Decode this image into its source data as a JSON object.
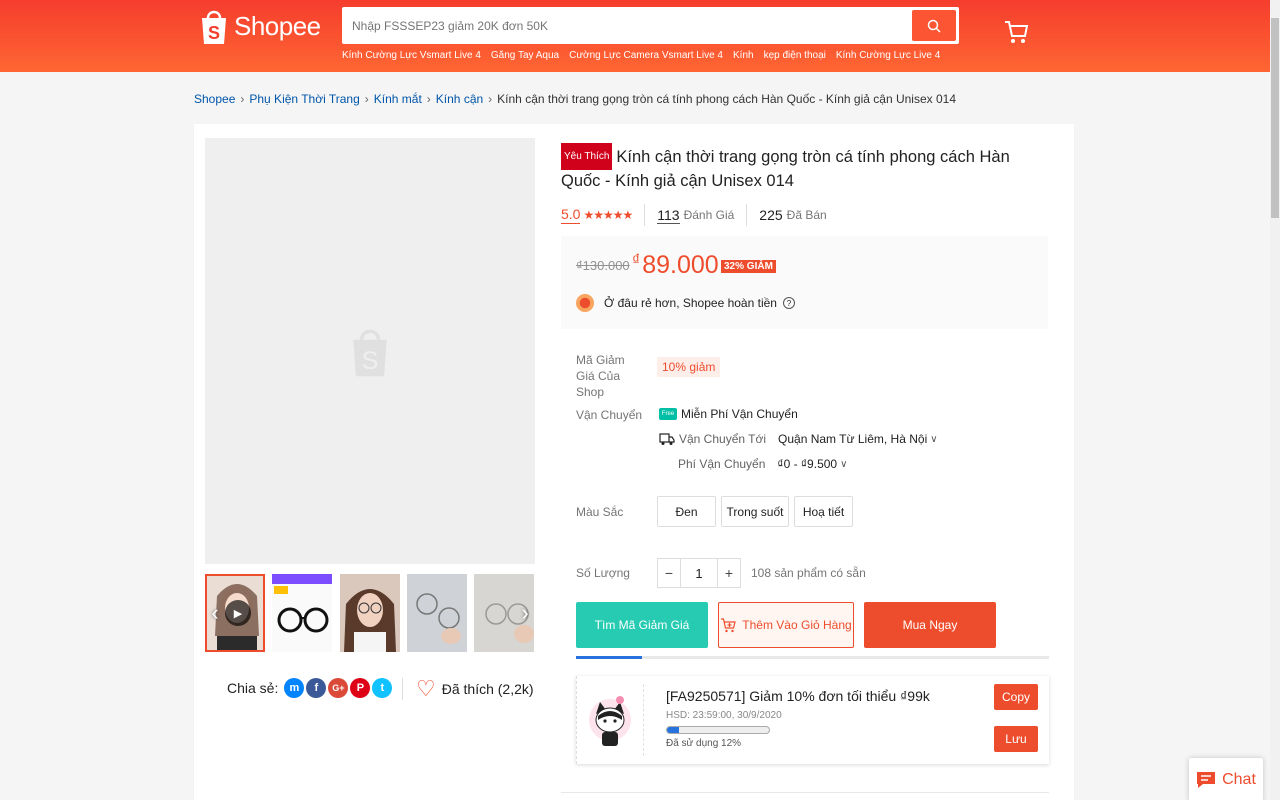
{
  "header": {
    "logo_text": "Shopee",
    "search_placeholder": "Nhập FSSSEP23 giảm 20K đơn 50K",
    "hot_words": [
      "Kính Cường Lực Vsmart Live 4",
      "Găng Tay Aqua",
      "Cường Lực Camera Vsmart Live 4",
      "Kính",
      "kẹp điện thoại",
      "Kính Cường Lực Live 4"
    ],
    "brand_color": "#ee4d2d"
  },
  "breadcrumb": [
    "Shopee",
    "Phụ Kiện Thời Trang",
    "Kính mắt",
    "Kính cận",
    "Kính cận thời trang gọng tròn cá tính phong cách Hàn Quốc - Kính giả cận Unisex 014"
  ],
  "product": {
    "badge": "Yêu Thích",
    "title": "Kính cận thời trang gọng tròn cá tính phong cách Hàn Quốc - Kính giả cận Unisex 014",
    "rating": "5.0",
    "stars": "★★★★★",
    "reviews_count": "113",
    "reviews_label": "Đánh Giá",
    "sold_count": "225",
    "sold_label": "Đã Bán",
    "old_price": "₫130.000",
    "price_symbol": "₫",
    "price": "89.000",
    "discount": "32% GIẢM",
    "guarantee": "Ở đâu rẻ hơn, Shopee hoàn tiền"
  },
  "voucher_row": {
    "label": "Mã Giảm Giá Của Shop",
    "tag": "10% giảm"
  },
  "shipping": {
    "label": "Vận Chuyển",
    "free": "Miễn Phí Vận Chuyển",
    "free_icon_text": "Free",
    "to_label": "Vận Chuyển Tới",
    "to_value": "Quận Nam Từ Liêm, Hà Nội",
    "fee_label": "Phí Vận Chuyển",
    "fee_value": "₫0 - ₫9.500"
  },
  "color": {
    "label": "Màu Sắc",
    "options": [
      "Đen",
      "Trong suốt",
      "Hoạ tiết"
    ]
  },
  "quantity": {
    "label": "Số Lượng",
    "minus": "−",
    "value": "1",
    "plus": "+",
    "stock": "108 sản phẩm có sẵn"
  },
  "actions": {
    "find_voucher": "Tìm Mã Giảm Giá",
    "add_to_cart": "Thêm Vào Giỏ Hàng",
    "buy_now": "Mua Ngay"
  },
  "voucher_card": {
    "title": "[FA9250571] Giảm 10% đơn tối thiểu ₫99k",
    "expiry": "HSD: 23:59:00, 30/9/2020",
    "used_label": "Đã sử dụng 12%",
    "used_fraction": 0.12,
    "copy": "Copy",
    "save": "Lưu"
  },
  "share": {
    "label": "Chia sẻ:",
    "like_label": "Đã thích (2,2k)",
    "social": [
      {
        "icon": "messenger-icon",
        "glyph": "m",
        "color": "#0084ff"
      },
      {
        "icon": "facebook-icon",
        "glyph": "f",
        "color": "#3b5999"
      },
      {
        "icon": "google-plus-icon",
        "glyph": "G+",
        "color": "#db4a39"
      },
      {
        "icon": "pinterest-icon",
        "glyph": "P",
        "color": "#de0217"
      },
      {
        "icon": "twitter-icon",
        "glyph": "t",
        "color": "#10c2ff"
      }
    ]
  },
  "chat": {
    "label": "Chat"
  }
}
